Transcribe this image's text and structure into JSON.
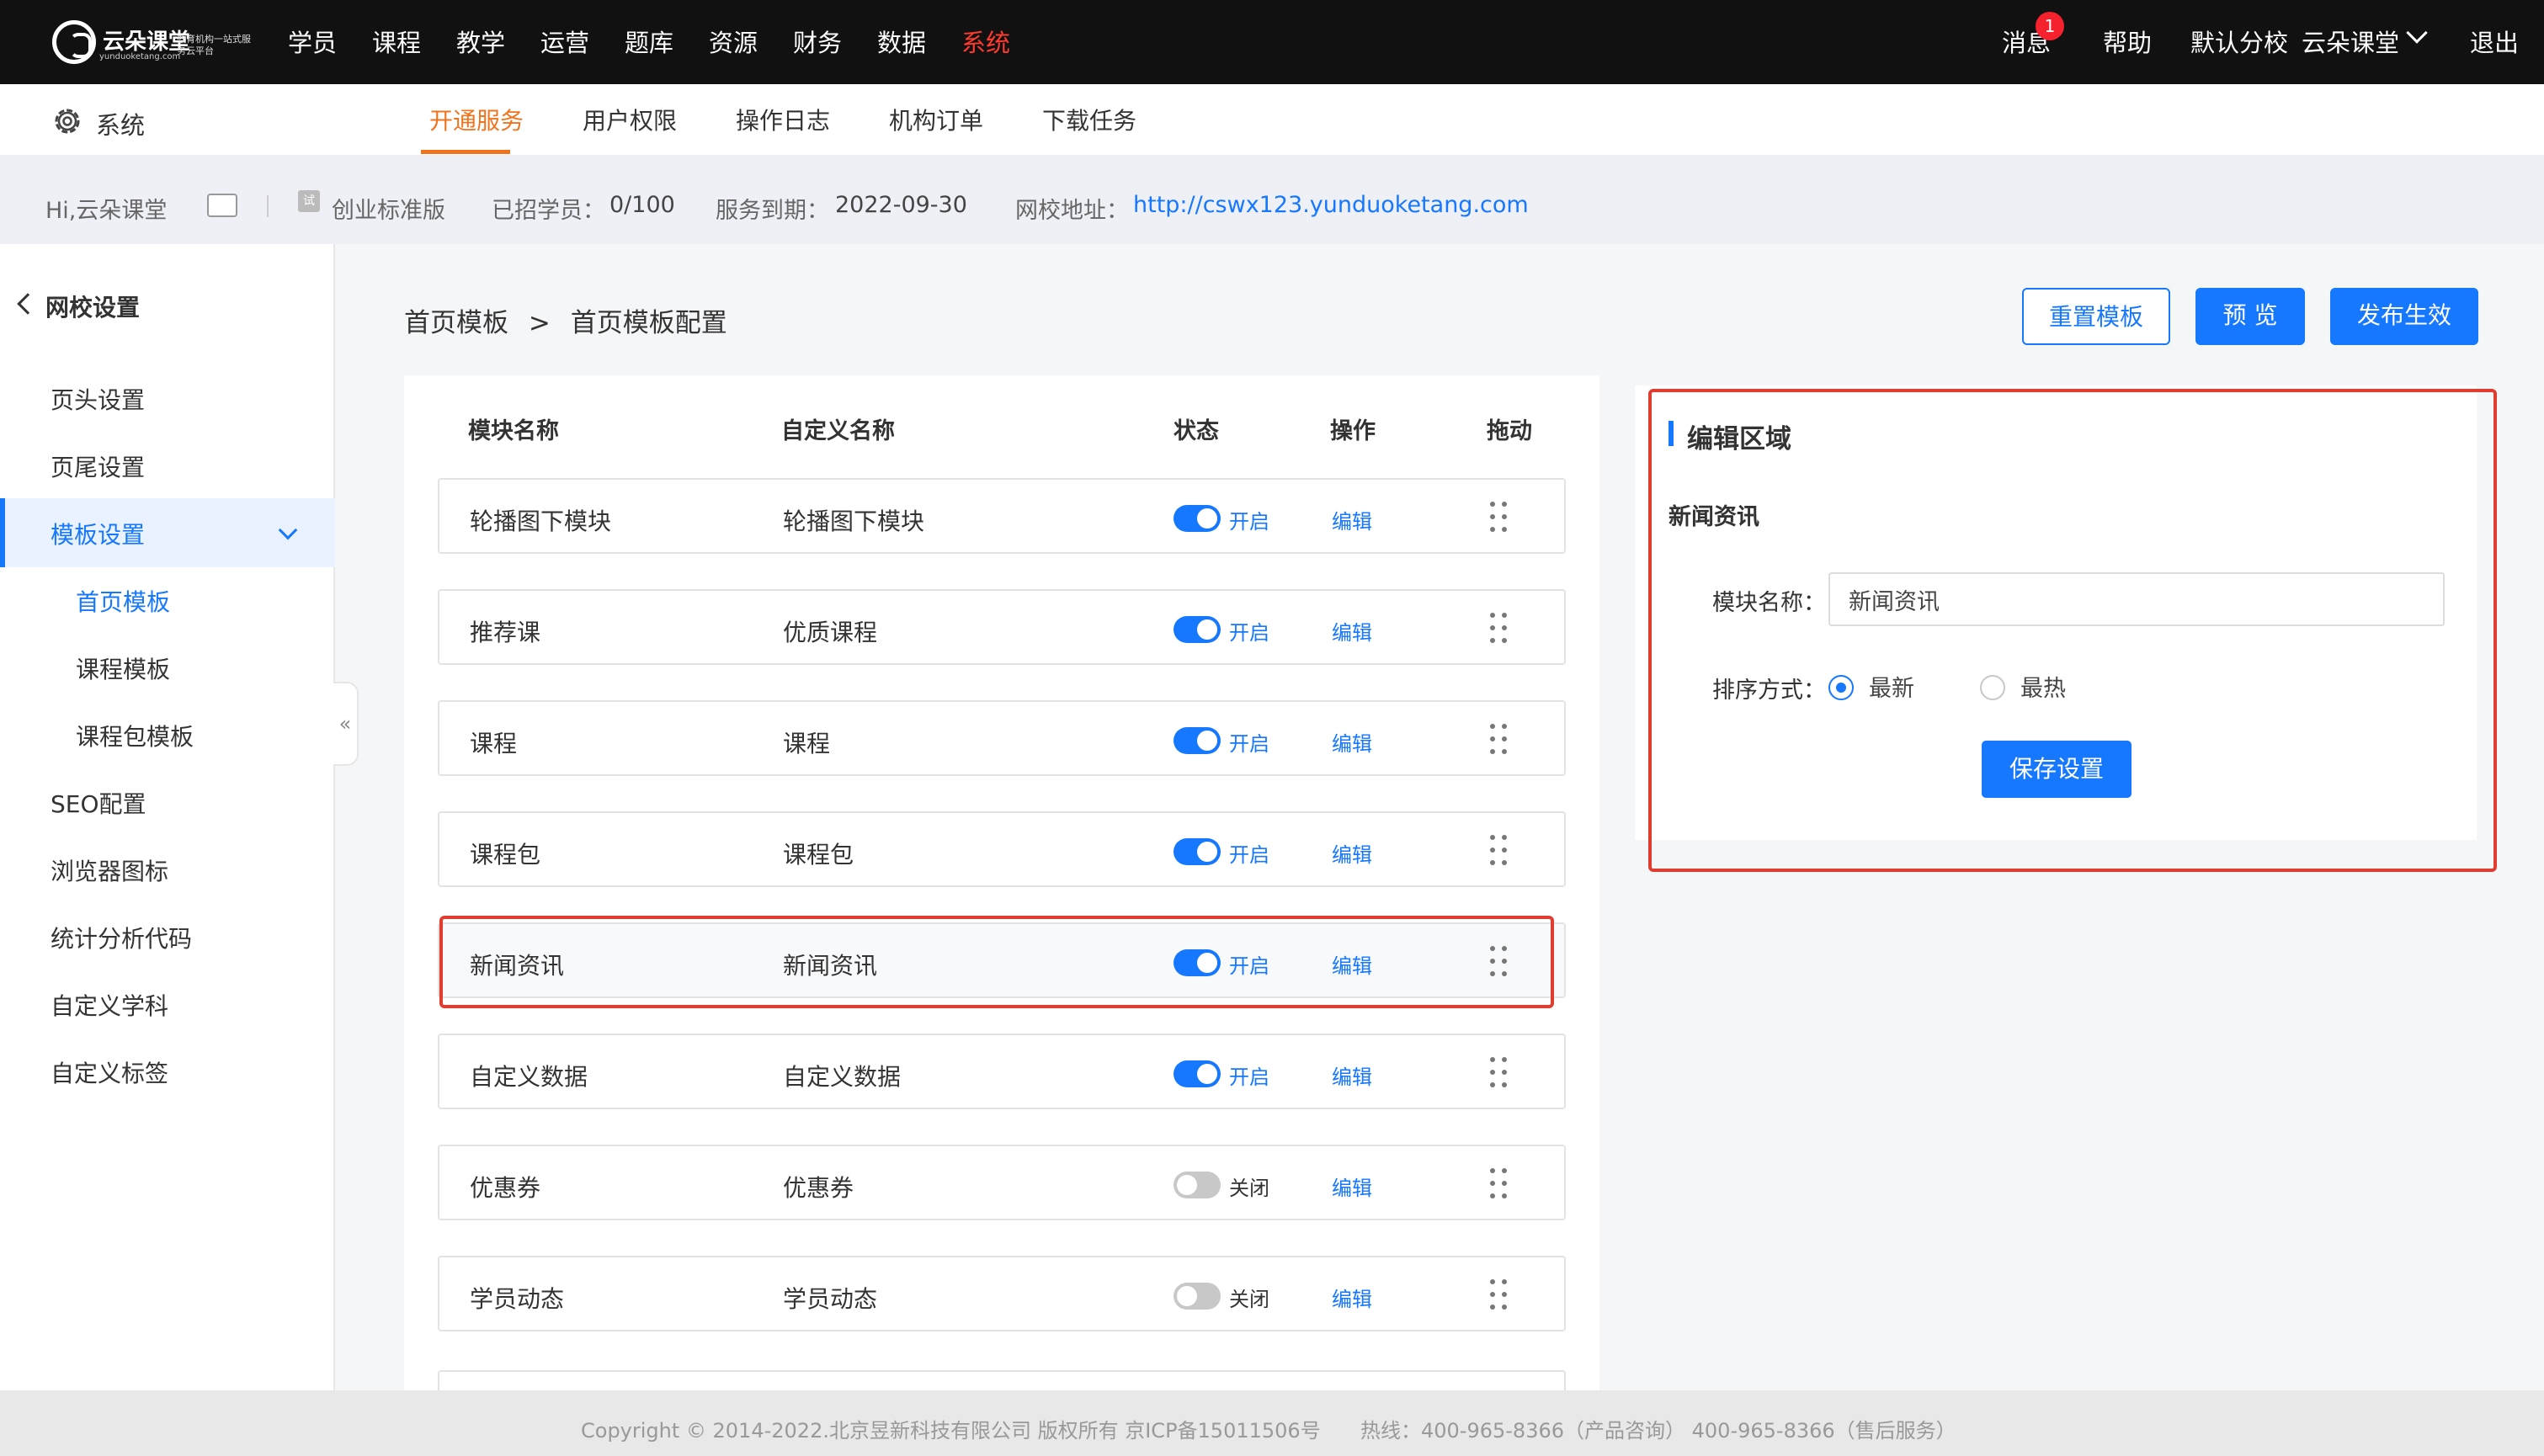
{
  "topbar": {
    "logo_text": "云朵课堂",
    "logo_sub": "教育机构一站式服务云平台",
    "logo_url": "yunduoketang.com",
    "nav": [
      "学员",
      "课程",
      "教学",
      "运营",
      "题库",
      "资源",
      "财务",
      "数据",
      "系统"
    ],
    "active_nav": "系统",
    "messages_label": "消息",
    "messages_badge": "1",
    "help_label": "帮助",
    "branch_label": "默认分校",
    "user_label": "云朵课堂",
    "logout_label": "退出"
  },
  "subnav": {
    "title": "系统",
    "tabs": [
      "开通服务",
      "用户权限",
      "操作日志",
      "机构订单",
      "下载任务"
    ],
    "active_tab": "开通服务"
  },
  "info": {
    "greeting": "Hi,云朵课堂",
    "edition": "创业标准版",
    "students_label": "已招学员：",
    "students_value": "0/100",
    "expiry_label": "服务到期：",
    "expiry_value": "2022-09-30",
    "url_label": "网校地址：",
    "url_value": "http://cswx123.yunduoketang.com",
    "trial_tag": "试"
  },
  "sidebar": {
    "title": "网校设置",
    "items": [
      {
        "label": "页头设置"
      },
      {
        "label": "页尾设置"
      },
      {
        "label": "模板设置",
        "active": true
      },
      {
        "label": "首页模板",
        "sub": true,
        "selected": true
      },
      {
        "label": "课程模板",
        "sub": true
      },
      {
        "label": "课程包模板",
        "sub": true
      },
      {
        "label": "SEO配置"
      },
      {
        "label": "浏览器图标"
      },
      {
        "label": "统计分析代码"
      },
      {
        "label": "自定义学科"
      },
      {
        "label": "自定义标签"
      }
    ],
    "collapse_glyph": "«"
  },
  "breadcrumb": {
    "root": "首页模板",
    "separator": ">",
    "current": "首页模板配置"
  },
  "actions": {
    "reset": "重置模板",
    "preview": "预 览",
    "publish": "发布生效"
  },
  "table": {
    "headers": [
      "模块名称",
      "自定义名称",
      "状态",
      "操作",
      "拖动"
    ],
    "rows": [
      {
        "name": "轮播图下模块",
        "custom": "轮播图下模块",
        "on": true,
        "status": "开启",
        "action": "编辑"
      },
      {
        "name": "推荐课",
        "custom": "优质课程",
        "on": true,
        "status": "开启",
        "action": "编辑"
      },
      {
        "name": "课程",
        "custom": "课程",
        "on": true,
        "status": "开启",
        "action": "编辑"
      },
      {
        "name": "课程包",
        "custom": "课程包",
        "on": true,
        "status": "开启",
        "action": "编辑"
      },
      {
        "name": "新闻资讯",
        "custom": "新闻资讯",
        "on": true,
        "status": "开启",
        "action": "编辑",
        "highlighted": true
      },
      {
        "name": "自定义数据",
        "custom": "自定义数据",
        "on": true,
        "status": "开启",
        "action": "编辑"
      },
      {
        "name": "优惠券",
        "custom": "优惠券",
        "on": false,
        "status": "关闭",
        "action": "编辑"
      },
      {
        "name": "学员动态",
        "custom": "学员动态",
        "on": false,
        "status": "关闭",
        "action": "编辑"
      }
    ]
  },
  "edit_panel": {
    "title": "编辑区域",
    "module": "新闻资讯",
    "name_label": "模块名称：",
    "name_value": "新闻资讯",
    "sort_label": "排序方式：",
    "sort_options": [
      "最新",
      "最热"
    ],
    "sort_selected": "最新",
    "save": "保存设置"
  },
  "footer": {
    "copyright": "Copyright © 2014-2022.北京昱新科技有限公司 版权所有 京ICP备15011506号",
    "hotline": "热线：400-965-8366（产品咨询） 400-965-8366（售后服务）"
  },
  "colors": {
    "accent": "#1677ff",
    "active_tab": "#f0741e",
    "active_nav": "#ff3b30",
    "highlight_frame": "#e03c30"
  }
}
